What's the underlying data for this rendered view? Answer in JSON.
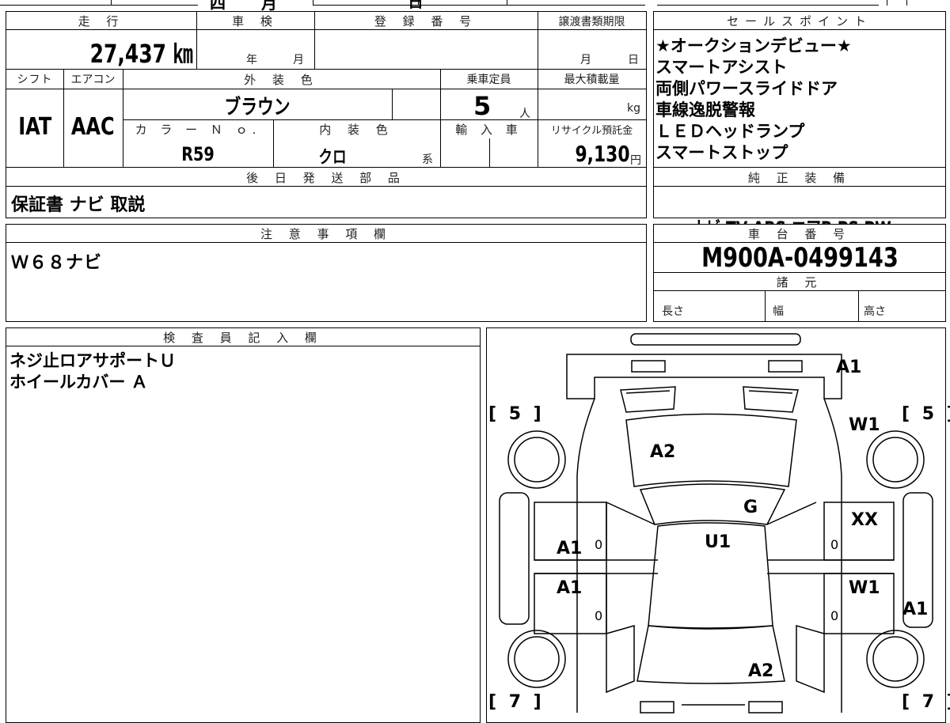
{
  "top_partial": [
    "四",
    "月",
    "日"
  ],
  "mileage": {
    "label": "走 行",
    "value": "27,437 ㎞"
  },
  "shaken": {
    "label": "車 検",
    "year_unit": "年",
    "month_unit": "月"
  },
  "registration": {
    "label": "登 録 番 号"
  },
  "transfer_deadline": {
    "label": "譲渡書類期限",
    "month_unit": "月",
    "day_unit": "日"
  },
  "shift": {
    "label": "シフト",
    "value": "IAT"
  },
  "aircon": {
    "label": "エアコン",
    "value": "AAC"
  },
  "exterior_color": {
    "label": "外 装 色",
    "value": "ブラウン"
  },
  "capacity": {
    "label": "乗車定員",
    "value": "5",
    "unit": "人"
  },
  "max_load": {
    "label": "最大積載量",
    "unit": "kg"
  },
  "color_no": {
    "label": "カ ラ ー Ｎ ｏ.",
    "value": "R59"
  },
  "interior_color": {
    "label": "内 装 色",
    "value": "クロ",
    "suffix": "系"
  },
  "import": {
    "label": "輸 入 車"
  },
  "recycle": {
    "label": "リサイクル預託金",
    "value": "9,130",
    "unit": "円"
  },
  "later_parts": {
    "label": "後 日 発 送 部 品",
    "value": "保証書 ナビ 取説"
  },
  "sales_points": {
    "label": "セールスポイント",
    "items": [
      "★オークションデビュー★",
      "スマートアシスト",
      "両側パワースライドドア",
      "車線逸脱警報",
      "ＬＥＤヘッドランプ",
      "スマートストップ"
    ]
  },
  "genuine_equipment": {
    "label": "純 正 装 備",
    "value": "ナビ  TV  ABS  エアB  PS  PW"
  },
  "notes": {
    "label": "注 意 事 項 欄",
    "value": "Ｗ６８ナビ"
  },
  "chassis_number": {
    "label": "車 台 番 号",
    "value": "M900A-0499143"
  },
  "specs": {
    "label": "諸 元",
    "length": "長さ",
    "width": "幅",
    "height": "高さ"
  },
  "inspector": {
    "label": "検 査 員 記 入 欄",
    "lines": [
      "ネジ止ロアサポートＵ",
      "ホイールカバー Ａ"
    ]
  },
  "diagram": {
    "tire_fl": "[ 5 ]",
    "tire_fr": "[ 5 ]",
    "tire_rl": "[ 7 ]",
    "tire_rr": "[ 7 ]",
    "bumper_front": "A1",
    "fender_right": "W1",
    "hood": "A2",
    "windshield": "G",
    "roof": "U1",
    "door_fl": "A1",
    "door_fl_zero": "0",
    "door_rl": "A1",
    "door_rl_zero": "0",
    "door_fr": "XX",
    "door_fr_zero": "0",
    "door_rr": "W1",
    "door_rr_zero": "0",
    "rear_quarter_r": "A1",
    "back_door": "A2"
  }
}
